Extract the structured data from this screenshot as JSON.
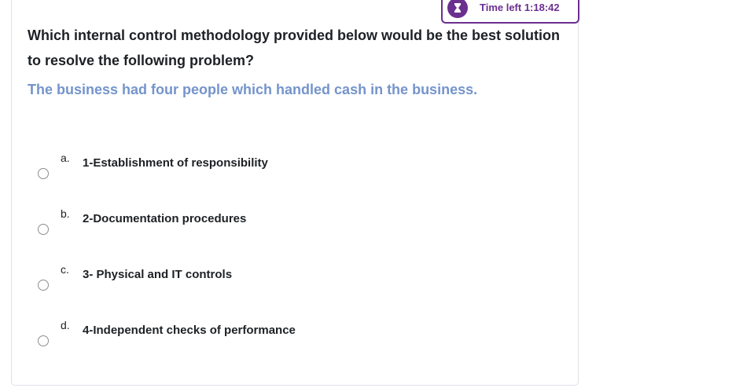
{
  "timer": {
    "label": "Time left 1:18:42",
    "icon": "hourglass-icon"
  },
  "question": {
    "text": "Which internal control methodology provided below would be the best solution to resolve the following problem?",
    "prompt": "The business had four people which handled cash in the business."
  },
  "answers": [
    {
      "letter": "a.",
      "text": "1-Establishment of responsibility"
    },
    {
      "letter": "b.",
      "text": "2-Documentation procedures"
    },
    {
      "letter": "c.",
      "text": "3- Physical and IT controls"
    },
    {
      "letter": "d.",
      "text": "4-Independent checks of performance"
    }
  ],
  "colors": {
    "accent": "#6b2f8f",
    "prompt": "#7494cc",
    "text": "#1d2125"
  }
}
